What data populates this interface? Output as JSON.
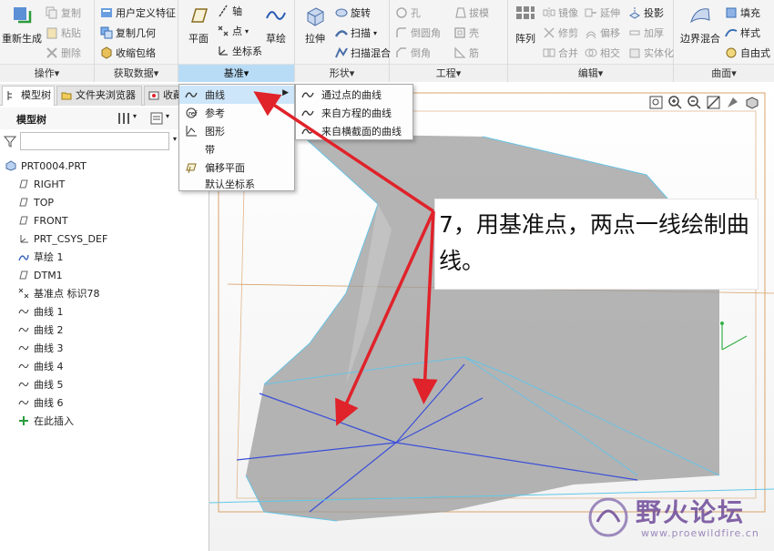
{
  "ribbon": {
    "groups": {
      "operations": {
        "label": "操作▾",
        "regenerate": "重新生成",
        "copy": "复制",
        "paste": "粘贴",
        "delete": "删除"
      },
      "get_data": {
        "label": "获取数据▾",
        "udf": "用户定义特征",
        "copy_geometry": "复制几何",
        "shrinkwrap": "收缩包络"
      },
      "datum": {
        "label": "基准▾",
        "plane": "平面",
        "axis": "轴",
        "point": "点",
        "csys": "坐标系",
        "sketch": "草绘"
      },
      "shapes": {
        "label": "形状▾",
        "extrude": "拉伸",
        "revolve": "旋转",
        "sweep": "扫描",
        "swept_blend": "扫描混合"
      },
      "engineering": {
        "label": "工程▾",
        "hole": "孔",
        "round": "倒圆角",
        "chamfer": "倒角",
        "draft": "拔模",
        "shell": "壳",
        "rib": "筋"
      },
      "editing": {
        "label": "编辑▾",
        "pattern": "阵列",
        "mirror": "镜像",
        "trim": "修剪",
        "merge": "合并",
        "extend": "延伸",
        "offset": "偏移",
        "intersect": "相交",
        "project": "投影",
        "thicken": "加厚",
        "solidify": "实体化"
      },
      "surfaces": {
        "label": "曲面▾",
        "boundary_blend": "边界混合",
        "fill": "填充",
        "style": "样式",
        "freestyle": "自由式"
      }
    }
  },
  "panel": {
    "tabs": [
      "模型树",
      "文件夹浏览器",
      "收藏"
    ],
    "tree_title": "模型树",
    "filter_placeholder": "",
    "items": [
      {
        "label": "PRT0004.PRT",
        "icon": "part-icon"
      },
      {
        "label": "RIGHT",
        "icon": "datum-plane-icon"
      },
      {
        "label": "TOP",
        "icon": "datum-plane-icon"
      },
      {
        "label": "FRONT",
        "icon": "datum-plane-icon"
      },
      {
        "label": "PRT_CSYS_DEF",
        "icon": "csys-icon"
      },
      {
        "label": "草绘 1",
        "icon": "sketch-icon"
      },
      {
        "label": "DTM1",
        "icon": "datum-plane-icon"
      },
      {
        "label": "基准点 标识78",
        "icon": "datum-point-icon"
      },
      {
        "label": "曲线 1",
        "icon": "curve-icon"
      },
      {
        "label": "曲线 2",
        "icon": "curve-icon"
      },
      {
        "label": "曲线 3",
        "icon": "curve-icon"
      },
      {
        "label": "曲线 4",
        "icon": "curve-icon"
      },
      {
        "label": "曲线 5",
        "icon": "curve-icon"
      },
      {
        "label": "曲线 6",
        "icon": "curve-icon"
      },
      {
        "label": "在此插入",
        "icon": "insert-here-icon"
      }
    ]
  },
  "datum_menu": {
    "items": [
      "曲线",
      "参考",
      "图形",
      "带",
      "偏移平面",
      "默认坐标系"
    ]
  },
  "curve_submenu": {
    "items": [
      "通过点的曲线",
      "来自方程的曲线",
      "来自横截面的曲线"
    ]
  },
  "annotation": {
    "text": "7，用基准点，两点一线绘制曲线。"
  },
  "watermark": {
    "title": "野火论坛",
    "url": "www.proewildfire.cn"
  },
  "colors": {
    "accent": "#b9dcf6",
    "arrow": "#e0222a",
    "model_edges": "#3a4fd8"
  }
}
